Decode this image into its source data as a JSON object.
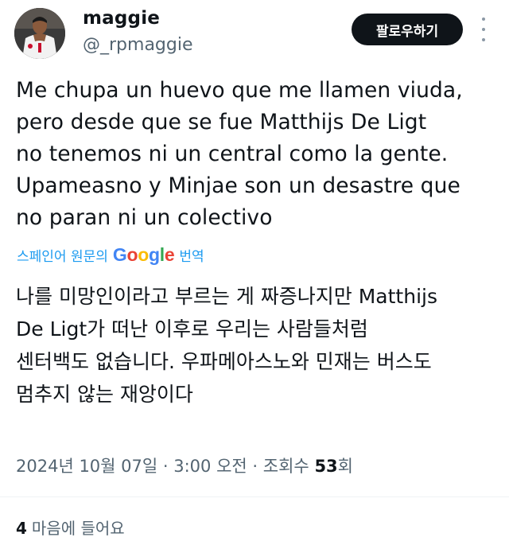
{
  "user": {
    "display_name": "maggie",
    "handle": "@_rpmaggie"
  },
  "follow_button": {
    "label": "팔로우하기"
  },
  "tweet": {
    "lines": [
      "Me chupa un huevo que me llamen viuda,",
      "pero desde que se fue Matthijs De Ligt",
      "no tenemos ni un central como la gente.",
      "Upameasno y Minjae son un desastre que",
      "no paran ni un colectivo"
    ]
  },
  "translation": {
    "prefix": "스페인어 원문의",
    "google": "Google",
    "suffix": "번역",
    "lines": [
      "나를 미망인이라고 부르는 게 짜증나지만 Matthijs",
      "De Ligt가 떠난 이후로 우리는 사람들처럼",
      "센터백도 없습니다. 우파메아스노와 민재는 버스도",
      "멈추지 않는 재앙이다"
    ]
  },
  "meta": {
    "date": "2024년 10월 07일",
    "time": "3:00 오전",
    "views_label": "조회수",
    "views_count": "53",
    "views_unit": "회"
  },
  "likes": {
    "count": "4",
    "label": "마음에 들어요"
  },
  "colors": {
    "accent": "#1d9bf0",
    "text": "#0f1419",
    "secondary": "#536471",
    "button_bg": "#0f1419"
  }
}
